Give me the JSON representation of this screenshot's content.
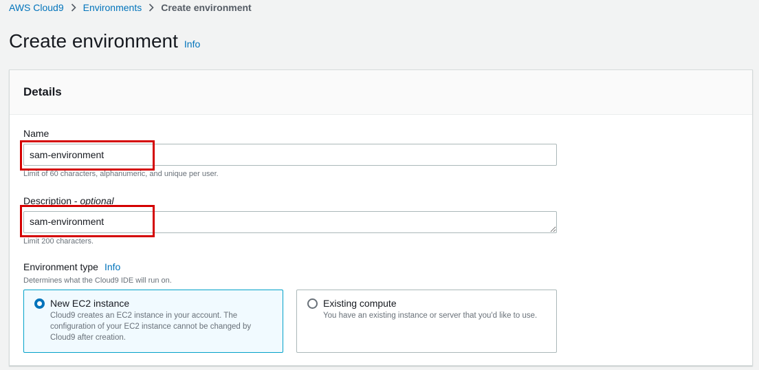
{
  "breadcrumb": {
    "items": [
      "AWS Cloud9",
      "Environments"
    ],
    "current": "Create environment"
  },
  "header": {
    "title": "Create environment",
    "info": "Info"
  },
  "details": {
    "title": "Details",
    "name": {
      "label": "Name",
      "value": "sam-environment",
      "hint": "Limit of 60 characters, alphanumeric, and unique per user."
    },
    "description": {
      "label": "Description",
      "optional": "optional",
      "value": "sam-environment",
      "hint": "Limit 200 characters."
    },
    "environment_type": {
      "label": "Environment type",
      "info": "Info",
      "hint": "Determines what the Cloud9 IDE will run on.",
      "options": [
        {
          "title": "New EC2 instance",
          "desc": "Cloud9 creates an EC2 instance in your account. The configuration of your EC2 instance cannot be changed by Cloud9 after creation.",
          "selected": true
        },
        {
          "title": "Existing compute",
          "desc": "You have an existing instance or server that you'd like to use.",
          "selected": false
        }
      ]
    }
  },
  "colors": {
    "link": "#0073bb",
    "highlight": "#d40000",
    "selected_tile_bg": "#f1faff",
    "selected_tile_border": "#00a1c9"
  }
}
